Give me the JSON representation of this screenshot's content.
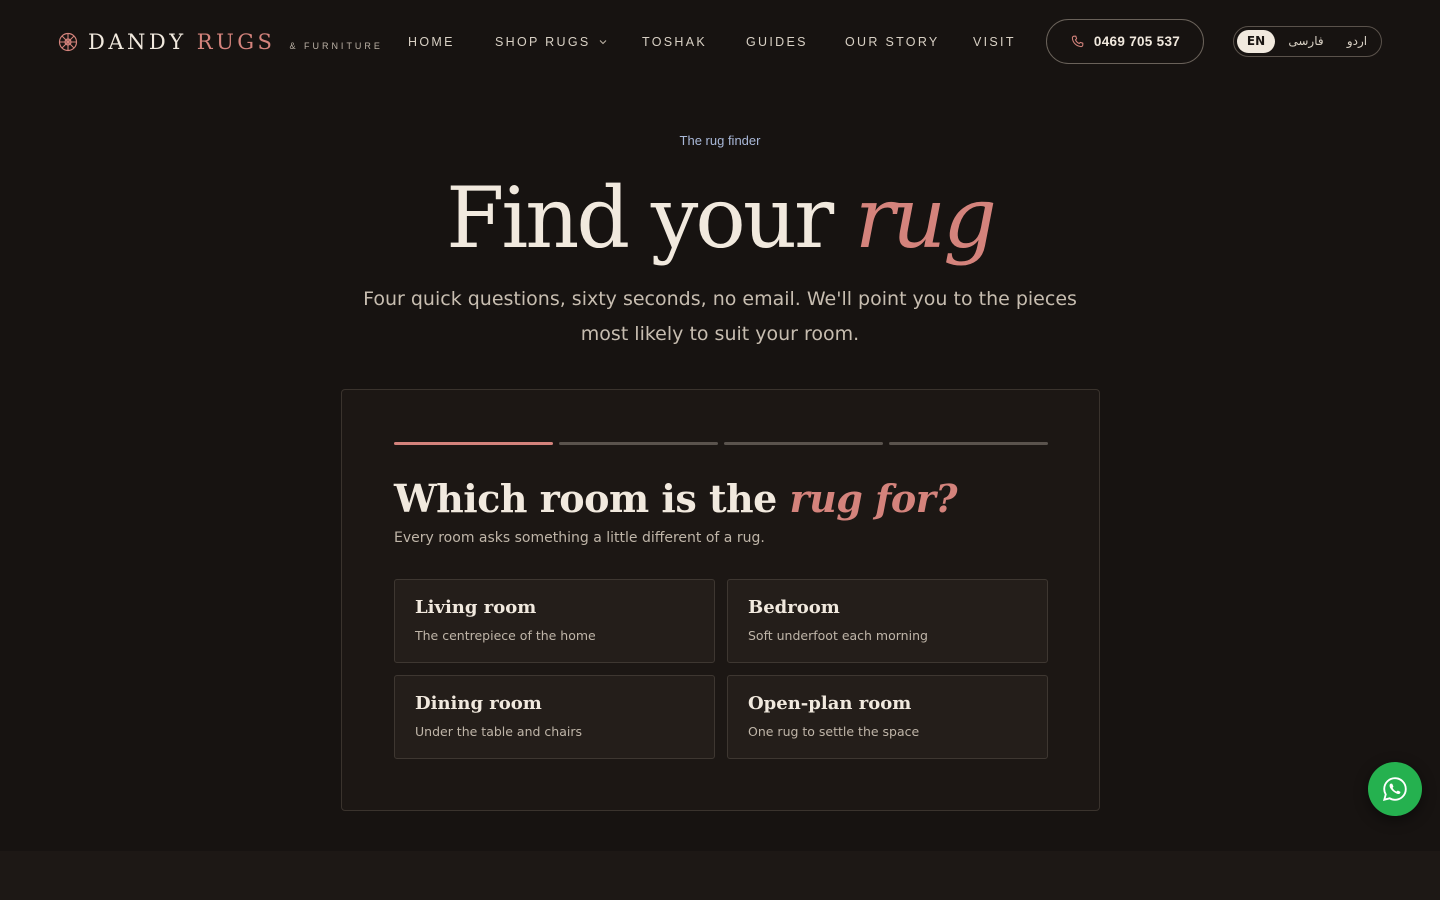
{
  "brand": {
    "name_main": "DANDY",
    "name_accent": "RUGS",
    "tagline": "& FURNITURE",
    "logo_icon": "rosette-icon"
  },
  "nav": {
    "items": [
      {
        "label": "HOME"
      },
      {
        "label": "SHOP RUGS",
        "has_dropdown": true
      },
      {
        "label": "TOSHAK"
      },
      {
        "label": "GUIDES"
      },
      {
        "label": "OUR STORY"
      },
      {
        "label": "VISIT"
      }
    ],
    "phone": "0469 705 537",
    "phone_icon": "phone-icon",
    "languages": [
      "EN",
      "فارسی",
      "اردو"
    ],
    "active_language": "EN"
  },
  "hero": {
    "eyebrow": "The rug finder",
    "title_main": "Find your",
    "title_accent": "rug",
    "subtitle": "Four quick questions, sixty seconds, no email. We'll point you to the pieces most likely to suit your room."
  },
  "quiz": {
    "progress_steps": 4,
    "progress_completed": 1,
    "question_main": "Which room is the",
    "question_accent": "rug for?",
    "question_sub": "Every room asks something a little different of a rug.",
    "options": [
      {
        "title": "Living room",
        "desc": "The centrepiece of the home"
      },
      {
        "title": "Bedroom",
        "desc": "Soft underfoot each morning"
      },
      {
        "title": "Dining room",
        "desc": "Under the table and chairs"
      },
      {
        "title": "Open-plan room",
        "desc": "One rug to settle the space"
      }
    ]
  },
  "floating": {
    "whatsapp_icon": "whatsapp-icon"
  },
  "colors": {
    "background": "#171311",
    "accent": "#d4837c",
    "text": "#f1e9de",
    "eyebrow": "#a9b8d8",
    "whatsapp": "#25b14f"
  }
}
